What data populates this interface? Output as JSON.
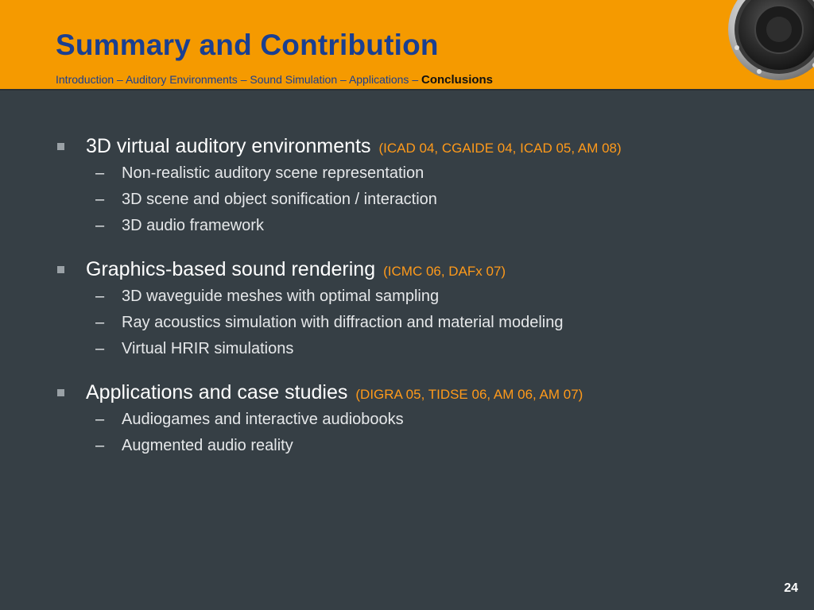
{
  "slide": {
    "title": "Summary and Contribution",
    "breadcrumb": {
      "items": [
        "Introduction",
        "Auditory Environments",
        "Sound Simulation",
        "Applications"
      ],
      "separator": " – ",
      "active": "Conclusions"
    },
    "page_number": "24"
  },
  "bullets": [
    {
      "text": "3D virtual auditory environments",
      "ref": "(ICAD 04, CGAIDE 04, ICAD 05, AM 08)",
      "subs": [
        "Non-realistic auditory scene representation",
        "3D scene and object sonification / interaction",
        "3D audio framework"
      ]
    },
    {
      "text": "Graphics-based sound rendering",
      "ref": "(ICMC 06, DAFx 07)",
      "subs": [
        "3D waveguide meshes with optimal sampling",
        "Ray acoustics simulation with diffraction and material modeling",
        "Virtual HRIR simulations"
      ]
    },
    {
      "text": "Applications and case studies",
      "ref": "(DIGRA 05, TIDSE 06, AM 06, AM 07)",
      "subs": [
        "Audiogames and interactive audiobooks",
        "Augmented audio reality"
      ]
    }
  ],
  "sub_dash": "–",
  "colors": {
    "header": "#f59a00",
    "background": "#363f45",
    "title": "#1a3f91",
    "reference": "#ff9a1a"
  },
  "icons": [
    "speaker-icon",
    "square-bullet-icon"
  ]
}
